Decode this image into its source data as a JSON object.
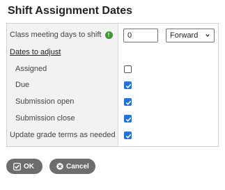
{
  "dialog": {
    "title": "Shift Assignment Dates"
  },
  "form": {
    "meeting_days_label": "Class meeting days to shift",
    "meeting_days_value": "0",
    "direction_selected": "Forward",
    "dates_to_adjust_label": "Dates to adjust",
    "rows": [
      {
        "label": "Assigned",
        "checked": false
      },
      {
        "label": "Due",
        "checked": true
      },
      {
        "label": "Submission open",
        "checked": true
      },
      {
        "label": "Submission close",
        "checked": true
      }
    ],
    "update_terms_label": "Update grade terms as needed",
    "update_terms_checked": true
  },
  "buttons": {
    "ok_label": "OK",
    "cancel_label": "Cancel"
  },
  "colors": {
    "accent": "#1a73e8",
    "info": "#3a9a2c",
    "button_bg": "#6d6d6d"
  },
  "icons": {
    "info": "info-icon",
    "ok": "check-square-icon",
    "cancel": "close-icon"
  }
}
